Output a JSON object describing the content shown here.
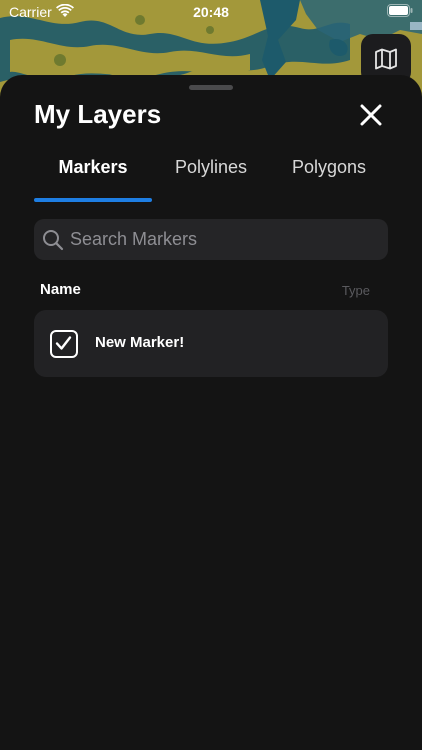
{
  "status_bar": {
    "carrier": "Carrier",
    "time": "20:48"
  },
  "map": {
    "button_icon": "map-icon",
    "colors": {
      "land": "#a3983a",
      "water": "#1d5a6b",
      "shore": "#6f7a2f"
    }
  },
  "sheet": {
    "title": "My Layers",
    "close_icon": "close-icon"
  },
  "tabs": [
    {
      "label": "Markers",
      "active": true
    },
    {
      "label": "Polylines",
      "active": false
    },
    {
      "label": "Polygons",
      "active": false
    }
  ],
  "search": {
    "placeholder": "Search Markers",
    "value": ""
  },
  "list": {
    "header_name": "Name",
    "header_type": "Type",
    "rows": [
      {
        "label": "New Marker!",
        "checked": true
      }
    ]
  },
  "colors": {
    "accent": "#1e7ee3",
    "background": "#141414",
    "row_background": "#222224"
  }
}
